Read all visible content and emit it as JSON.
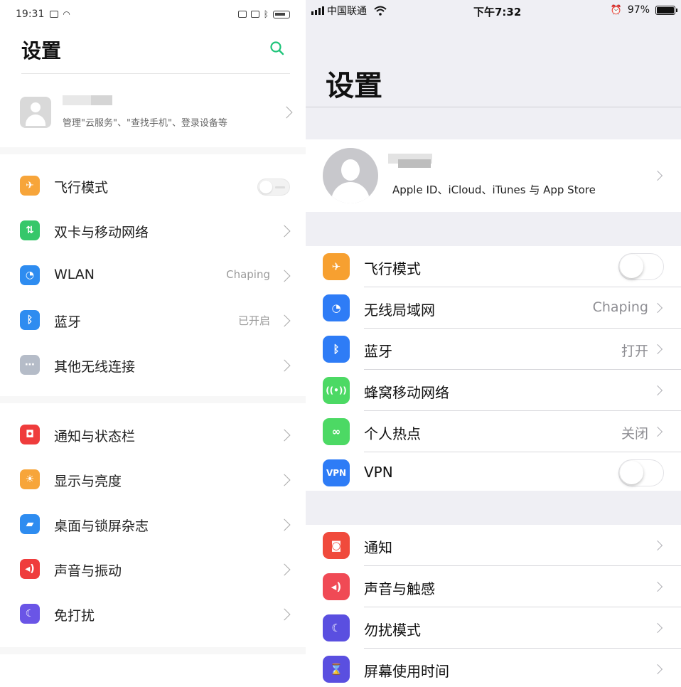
{
  "left": {
    "status": {
      "time": "19:31"
    },
    "title": "设置",
    "profile": {
      "subtitle": "管理\"云服务\"、\"查找手机\"、登录设备等"
    },
    "items": [
      {
        "label": "飞行模式",
        "value": "",
        "icon": "airplane-icon",
        "color": "#f7a53a",
        "glyph": "✈",
        "type": "toggle"
      },
      {
        "label": "双卡与移动网络",
        "value": "",
        "icon": "sim-icon",
        "color": "#36c76a",
        "glyph": "⇅",
        "type": "chevron"
      },
      {
        "label": "WLAN",
        "value": "Chaping",
        "icon": "wifi-icon",
        "color": "#2e8cf0",
        "glyph": "◔",
        "type": "chevron"
      },
      {
        "label": "蓝牙",
        "value": "已开启",
        "icon": "bluetooth-icon",
        "color": "#2e8cf0",
        "glyph": "ᛒ",
        "type": "chevron"
      },
      {
        "label": "其他无线连接",
        "value": "",
        "icon": "more-connections-icon",
        "color": "#b5bcc8",
        "glyph": "⋯",
        "type": "chevron"
      },
      {
        "label": "通知与状态栏",
        "value": "",
        "icon": "notification-icon",
        "color": "#ef3c3c",
        "glyph": "◘",
        "type": "chevron"
      },
      {
        "label": "显示与亮度",
        "value": "",
        "icon": "brightness-icon",
        "color": "#f7a53a",
        "glyph": "☀",
        "type": "chevron"
      },
      {
        "label": "桌面与锁屏杂志",
        "value": "",
        "icon": "wallpaper-icon",
        "color": "#2e8cf0",
        "glyph": "▰",
        "type": "chevron"
      },
      {
        "label": "声音与振动",
        "value": "",
        "icon": "sound-icon",
        "color": "#ef3c3c",
        "glyph": "◂)",
        "type": "chevron"
      },
      {
        "label": "免打扰",
        "value": "",
        "icon": "moon-icon",
        "color": "#6a55e6",
        "glyph": "☾",
        "type": "chevron"
      }
    ]
  },
  "right": {
    "status": {
      "carrier": "中国联通",
      "time": "下午7:32",
      "battery": "97%"
    },
    "title": "设置",
    "profile": {
      "subtitle": "Apple ID、iCloud、iTunes 与 App Store"
    },
    "group1": [
      {
        "label": "飞行模式",
        "value": "",
        "icon": "airplane-icon",
        "color": "#f7a030",
        "glyph": "✈",
        "type": "toggle"
      },
      {
        "label": "无线局域网",
        "value": "Chaping",
        "icon": "wifi-icon",
        "color": "#2e7cf6",
        "glyph": "◔",
        "type": "chevron"
      },
      {
        "label": "蓝牙",
        "value": "打开",
        "icon": "bluetooth-icon",
        "color": "#2e7cf6",
        "glyph": "ᛒ",
        "type": "chevron"
      },
      {
        "label": "蜂窝移动网络",
        "value": "",
        "icon": "cellular-icon",
        "color": "#4cd964",
        "glyph": "((•))",
        "type": "chevron"
      },
      {
        "label": "个人热点",
        "value": "关闭",
        "icon": "hotspot-icon",
        "color": "#4cd964",
        "glyph": "∞",
        "type": "chevron"
      },
      {
        "label": "VPN",
        "value": "",
        "icon": "vpn-icon",
        "color": "#2e7cf6",
        "glyph": "VPN",
        "type": "toggle"
      }
    ],
    "group2": [
      {
        "label": "通知",
        "value": "",
        "icon": "notification-icon",
        "color": "#f04a3c",
        "glyph": "◙",
        "type": "chevron"
      },
      {
        "label": "声音与触感",
        "value": "",
        "icon": "sound-icon",
        "color": "#f04a55",
        "glyph": "◂)",
        "type": "chevron"
      },
      {
        "label": "勿扰模式",
        "value": "",
        "icon": "moon-icon",
        "color": "#5a4fe0",
        "glyph": "☾",
        "type": "chevron"
      },
      {
        "label": "屏幕使用时间",
        "value": "",
        "icon": "hourglass-icon",
        "color": "#5a4fe0",
        "glyph": "⌛",
        "type": "chevron"
      }
    ]
  }
}
